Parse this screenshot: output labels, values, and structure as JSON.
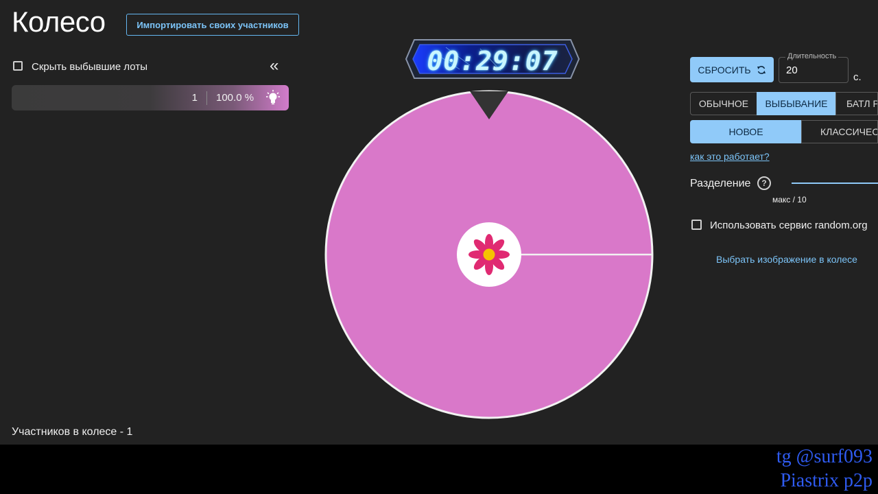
{
  "header": {
    "title": "Колесо",
    "import_button": "Импортировать своих участников"
  },
  "lots_panel": {
    "hide_eliminated_label": "Скрыть выбывшие лоты",
    "hide_eliminated_checked": false,
    "collapse_icon": "double-chevron-left-icon",
    "lots": [
      {
        "name": "",
        "count": "1",
        "percent": "100.0 %",
        "color": "#d27ccb",
        "icon": "lightbulb-icon"
      }
    ],
    "participants_text": "Участников в колесе - 1"
  },
  "timer": {
    "value": "00:29:07"
  },
  "wheel": {
    "segment_color": "#d978c9",
    "border_color": "#f2f2f2",
    "center_icon": "flower-icon",
    "pointer_icon": "pointer-triangle-icon"
  },
  "controls": {
    "reset_button": "СБРОСИТЬ",
    "reset_icon": "refresh-icon",
    "duration_label": "Длительность",
    "duration_value": "20",
    "duration_unit": "с.",
    "modes": [
      "ОБЫЧНОЕ",
      "ВЫБЫВАНИЕ",
      "БАТЛ Р"
    ],
    "active_mode": "ВЫБЫВАНИЕ",
    "variants": [
      "НОВОЕ",
      "КЛАССИЧЕСК"
    ],
    "active_variant": "НОВОЕ",
    "how_link": "как это работает?",
    "split_label": "Разделение",
    "help_icon": "question-circle-icon",
    "slider_label": "макс / 10",
    "random_org_label": "Использовать сервис random.org",
    "random_org_checked": false,
    "choose_image_link": "Выбрать изображение в колесе",
    "accent_color": "#90caf9"
  },
  "watermark": {
    "line1": "tg @surf093",
    "line2": "Piastrix p2p"
  }
}
